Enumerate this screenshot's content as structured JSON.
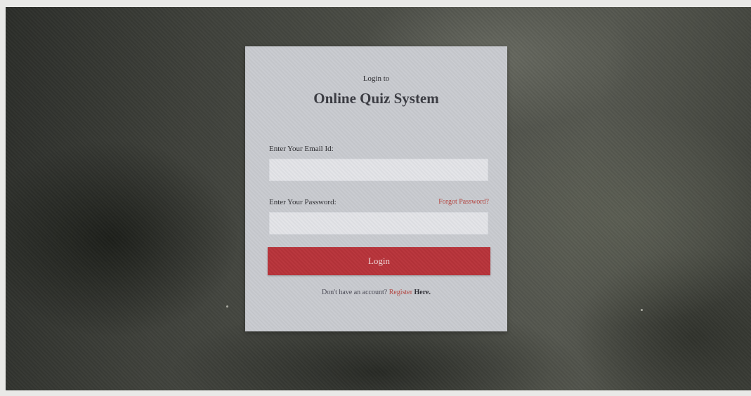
{
  "login_card": {
    "subtitle": "Login to",
    "title": "Online Quiz System",
    "email_label": "Enter Your Email Id:",
    "email_value": "",
    "password_label": "Enter Your Password:",
    "password_value": "",
    "forgot_link": "Forgot Password?",
    "login_button": "Login",
    "register_prompt": "Don't have an account?",
    "register_link": "Register",
    "register_here": "Here."
  },
  "colors": {
    "card_background": "#c9cbd0",
    "login_button": "#b8333a",
    "link": "#b5443f"
  }
}
